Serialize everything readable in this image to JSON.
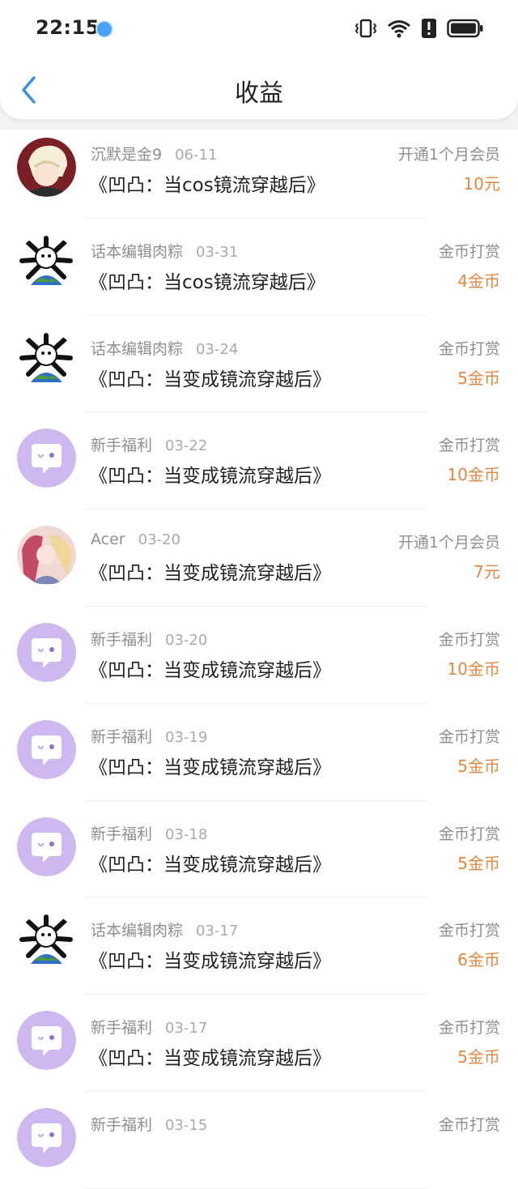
{
  "status": {
    "time": "22:15"
  },
  "header": {
    "title": "收益"
  },
  "records": [
    {
      "avatar": "photo-1",
      "name": "沉默是金9",
      "date": "06-11",
      "book": "《凹凸：当cos镜流穿越后》",
      "type": "开通1个月会员",
      "amount": "10元"
    },
    {
      "avatar": "earth",
      "name": "话本编辑肉粽",
      "date": "03-31",
      "book": "《凹凸：当cos镜流穿越后》",
      "type": "金币打赏",
      "amount": "4金币"
    },
    {
      "avatar": "earth",
      "name": "话本编辑肉粽",
      "date": "03-24",
      "book": "《凹凸：当变成镜流穿越后》",
      "type": "金币打赏",
      "amount": "5金币"
    },
    {
      "avatar": "chat-bubble",
      "name": "新手福利",
      "date": "03-22",
      "book": "《凹凸：当变成镜流穿越后》",
      "type": "金币打赏",
      "amount": "10金币"
    },
    {
      "avatar": "photo-2",
      "name": "Acer",
      "date": "03-20",
      "book": "《凹凸：当变成镜流穿越后》",
      "type": "开通1个月会员",
      "amount": "7元"
    },
    {
      "avatar": "chat-bubble",
      "name": "新手福利",
      "date": "03-20",
      "book": "《凹凸：当变成镜流穿越后》",
      "type": "金币打赏",
      "amount": "10金币"
    },
    {
      "avatar": "chat-bubble",
      "name": "新手福利",
      "date": "03-19",
      "book": "《凹凸：当变成镜流穿越后》",
      "type": "金币打赏",
      "amount": "5金币"
    },
    {
      "avatar": "chat-bubble",
      "name": "新手福利",
      "date": "03-18",
      "book": "《凹凸：当变成镜流穿越后》",
      "type": "金币打赏",
      "amount": "5金币"
    },
    {
      "avatar": "earth",
      "name": "话本编辑肉粽",
      "date": "03-17",
      "book": "《凹凸：当变成镜流穿越后》",
      "type": "金币打赏",
      "amount": "6金币"
    },
    {
      "avatar": "chat-bubble",
      "name": "新手福利",
      "date": "03-17",
      "book": "《凹凸：当变成镜流穿越后》",
      "type": "金币打赏",
      "amount": "5金币"
    },
    {
      "avatar": "chat-bubble",
      "name": "新手福利",
      "date": "03-15",
      "book": "",
      "type": "金币打赏",
      "amount": ""
    }
  ]
}
